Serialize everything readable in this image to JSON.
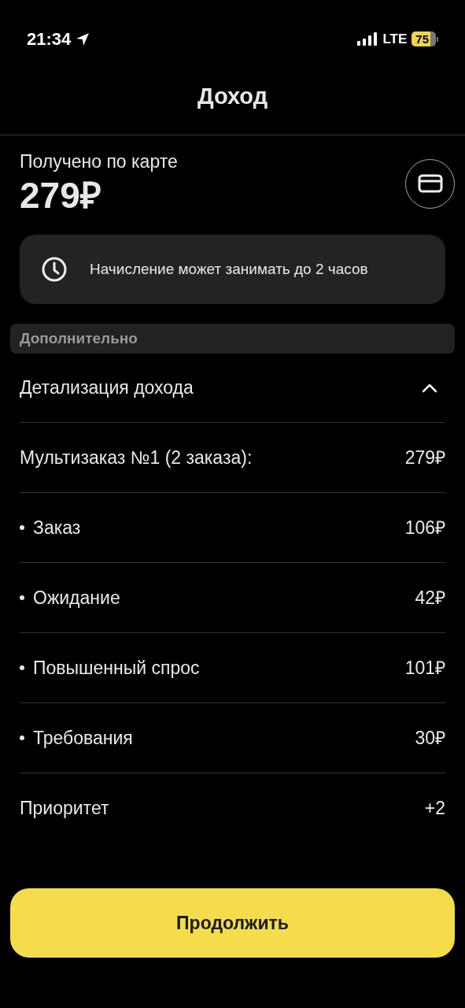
{
  "status_bar": {
    "time": "21:34",
    "network": "LTE",
    "battery": "75"
  },
  "header": {
    "title": "Доход"
  },
  "received": {
    "label": "Получено по карте",
    "amount": "279₽"
  },
  "notice": {
    "text": "Начисление может занимать до 2 часов"
  },
  "section": {
    "title": "Дополнительно"
  },
  "details": {
    "title": "Детализация дохода",
    "expanded": true,
    "rows": [
      {
        "kind": "plain",
        "label": "Мультизаказ №1 (2 заказа):",
        "value": "279₽"
      },
      {
        "kind": "bullet",
        "label": "Заказ",
        "value": "106₽"
      },
      {
        "kind": "bullet",
        "label": "Ожидание",
        "value": "42₽"
      },
      {
        "kind": "bullet",
        "label": "Повышенный спрос",
        "value": "101₽"
      },
      {
        "kind": "bullet",
        "label": "Требования",
        "value": "30₽"
      },
      {
        "kind": "plain",
        "label": "Приоритет",
        "value": "+2"
      }
    ]
  },
  "continue_button": {
    "label": "Продолжить"
  }
}
